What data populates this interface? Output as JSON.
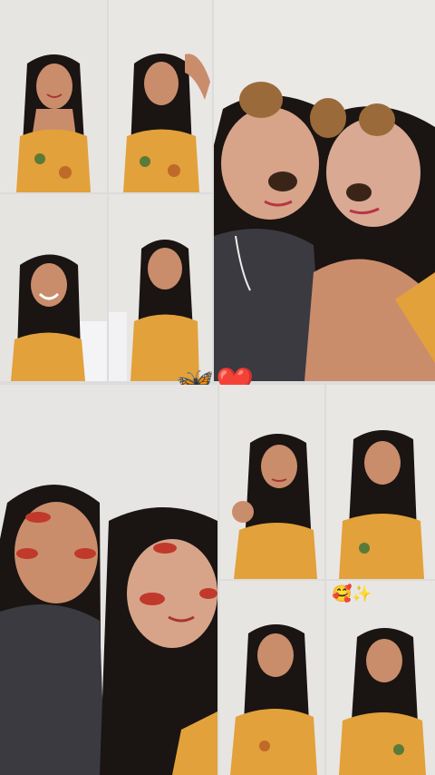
{
  "collage": {
    "background": "#dcdcdc",
    "wall_color": "#e8e6e3",
    "hair_color": "#1a1412",
    "skin_color": "#c98d6c",
    "dress_color": "#e2a13a",
    "top_color": "#3a3a40"
  },
  "stickers": {
    "butterfly": "🦋",
    "heart": "❤️",
    "hearts_face": "🥰",
    "sparkle": "✨"
  }
}
